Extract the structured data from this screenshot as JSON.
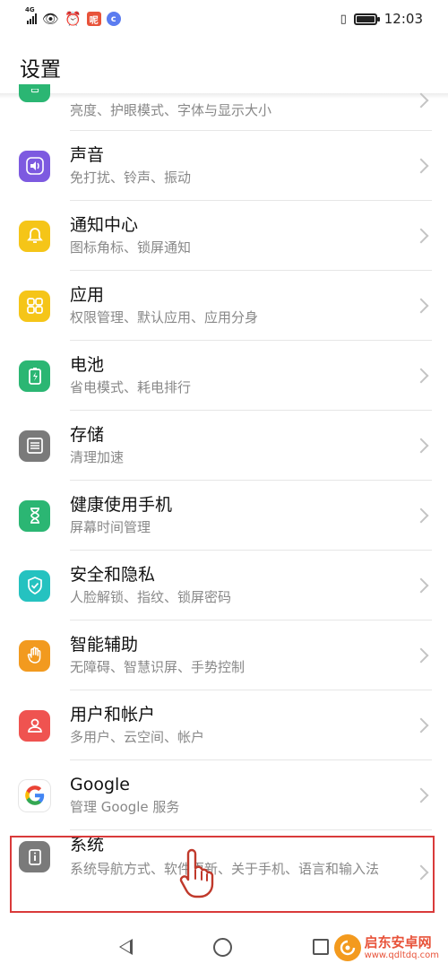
{
  "status": {
    "network": "4G",
    "time": "12:03",
    "app_badge_1": "呢",
    "app_badge_2": "c"
  },
  "header": {
    "title": "设置"
  },
  "items": [
    {
      "title": "",
      "subtitle": "亮度、护眼模式、字体与显示大小",
      "color": "#2bb673",
      "icon": "display-icon"
    },
    {
      "title": "声音",
      "subtitle": "免打扰、铃声、振动",
      "color": "#7d5ae0",
      "icon": "speaker-icon"
    },
    {
      "title": "通知中心",
      "subtitle": "图标角标、锁屏通知",
      "color": "#f5c518",
      "icon": "bell-icon"
    },
    {
      "title": "应用",
      "subtitle": "权限管理、默认应用、应用分身",
      "color": "#f5c518",
      "icon": "apps-grid-icon"
    },
    {
      "title": "电池",
      "subtitle": "省电模式、耗电排行",
      "color": "#2bb673",
      "icon": "battery-icon"
    },
    {
      "title": "存储",
      "subtitle": "清理加速",
      "color": "#7a7a7a",
      "icon": "storage-icon"
    },
    {
      "title": "健康使用手机",
      "subtitle": "屏幕时间管理",
      "color": "#2bb673",
      "icon": "hourglass-icon"
    },
    {
      "title": "安全和隐私",
      "subtitle": "人脸解锁、指纹、锁屏密码",
      "color": "#25c2c0",
      "icon": "shield-icon"
    },
    {
      "title": "智能辅助",
      "subtitle": "无障碍、智慧识屏、手势控制",
      "color": "#f29a1f",
      "icon": "hand-icon"
    },
    {
      "title": "用户和帐户",
      "subtitle": "多用户、云空间、帐户",
      "color": "#ef5350",
      "icon": "user-icon"
    },
    {
      "title": "Google",
      "subtitle": "管理 Google 服务",
      "color": "#ffffff",
      "icon": "google-icon"
    },
    {
      "title": "系统",
      "subtitle": "系统导航方式、软件更新、关于手机、语言和输入法",
      "color": "#7a7a7a",
      "icon": "info-icon"
    }
  ],
  "watermark": {
    "name": "启东安卓网",
    "url": "www.qdltdq.com"
  }
}
